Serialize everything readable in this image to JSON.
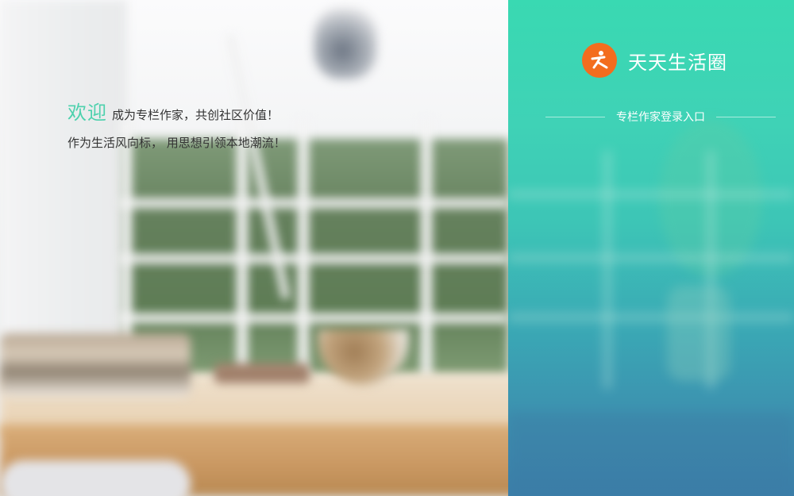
{
  "welcome": {
    "headline": "欢迎",
    "subline": "成为专栏作家，共创社区价值！",
    "line2": "作为生活风向标， 用思想引领本地潮流！"
  },
  "brand": {
    "name": "天天生活圈",
    "logo_icon": "running-person-icon",
    "logo_color": "#f36d1e"
  },
  "login": {
    "entry_label": "专栏作家登录入口"
  },
  "colors": {
    "accent": "#4dd1ad",
    "panel_top": "#39d9b2",
    "panel_bottom": "#3b7fa9"
  }
}
